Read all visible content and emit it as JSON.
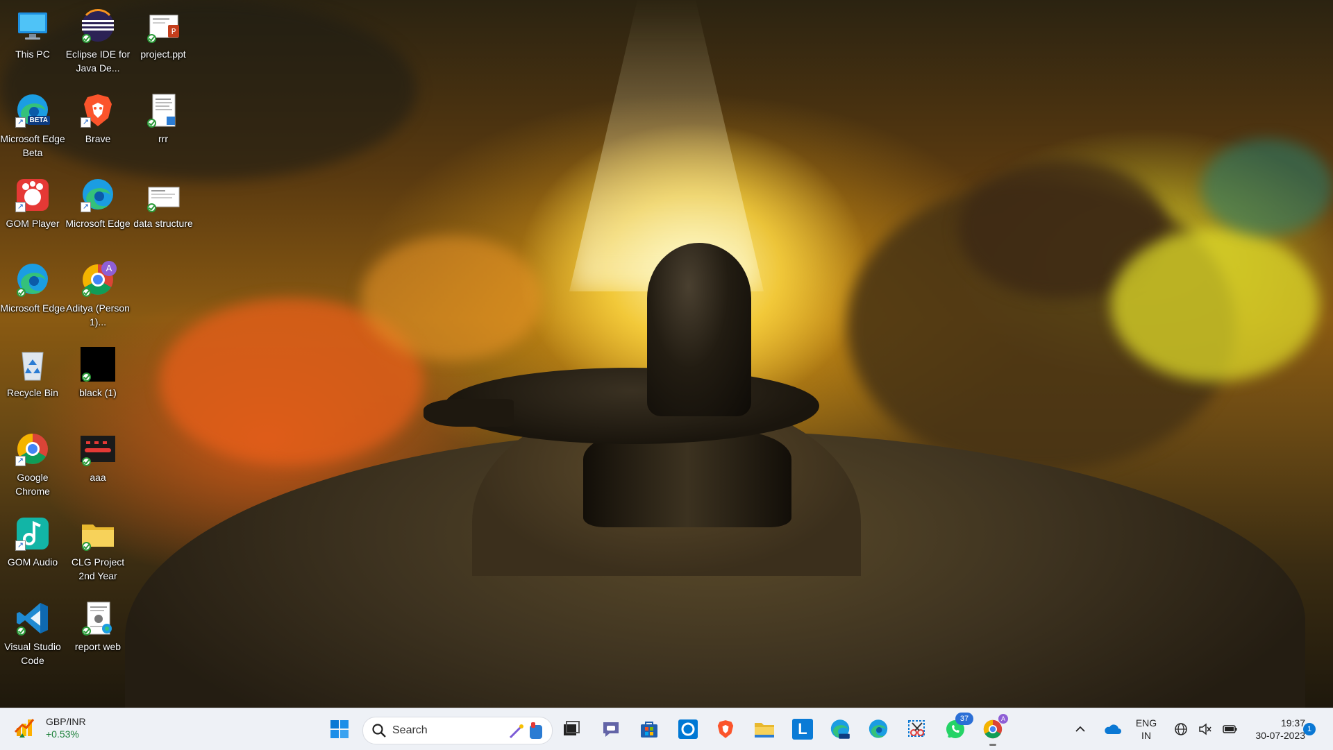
{
  "desktop": {
    "icons": [
      {
        "label": "This PC",
        "icon": "this-pc-icon"
      },
      {
        "label": "Eclipse IDE for Java De...",
        "icon": "eclipse-icon"
      },
      {
        "label": "project.ppt",
        "icon": "powerpoint-file-icon"
      },
      {
        "label": "Microsoft Edge Beta",
        "icon": "edge-beta-icon"
      },
      {
        "label": "Brave",
        "icon": "brave-icon"
      },
      {
        "label": "rrr",
        "icon": "document-icon"
      },
      {
        "label": "GOM Player",
        "icon": "gom-player-icon"
      },
      {
        "label": "Microsoft Edge",
        "icon": "edge-icon"
      },
      {
        "label": "data structure",
        "icon": "document-icon"
      },
      {
        "label": "Microsoft Edge",
        "icon": "edge-icon"
      },
      {
        "label": "Aditya (Person 1)...",
        "icon": "chrome-profile-icon"
      },
      {
        "label": "Recycle Bin",
        "icon": "recycle-bin-icon"
      },
      {
        "label": "black (1)",
        "icon": "image-file-icon"
      },
      {
        "label": "Google Chrome",
        "icon": "chrome-icon"
      },
      {
        "label": "aaa",
        "icon": "image-file-icon"
      },
      {
        "label": "GOM Audio",
        "icon": "gom-audio-icon"
      },
      {
        "label": "CLG Project 2nd Year",
        "icon": "folder-icon"
      },
      {
        "label": "Visual Studio Code",
        "icon": "vscode-icon"
      },
      {
        "label": "report web",
        "icon": "pdf-file-icon"
      }
    ],
    "beta_tag": "BETA",
    "chrome_avatar_letter": "A"
  },
  "taskbar": {
    "weather": {
      "pair": "GBP/INR",
      "change": "+0.53%"
    },
    "search": {
      "placeholder": "Search"
    },
    "apps": [
      {
        "icon": "start-icon"
      },
      {
        "icon": "task-view-icon"
      },
      {
        "icon": "teams-chat-icon"
      },
      {
        "icon": "microsoft-store-icon"
      },
      {
        "icon": "cortana-icon"
      },
      {
        "icon": "brave-icon"
      },
      {
        "icon": "file-explorer-icon"
      },
      {
        "icon": "l-app-icon",
        "letter": "L"
      },
      {
        "icon": "edge-beta-icon"
      },
      {
        "icon": "edge-icon"
      },
      {
        "icon": "snipping-tool-icon"
      },
      {
        "icon": "whatsapp-icon",
        "badge": "37"
      },
      {
        "icon": "chrome-icon"
      }
    ],
    "tray": {
      "lang_top": "ENG",
      "lang_bottom": "IN",
      "time": "19:37",
      "date": "30-07-2023",
      "notification_count": "1"
    }
  }
}
